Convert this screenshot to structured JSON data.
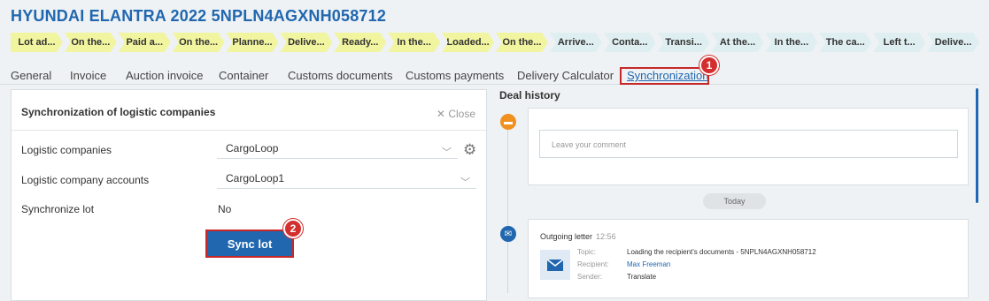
{
  "header": {
    "title": "HYUNDAI ELANTRA 2022 5NPLN4AGXNH058712"
  },
  "stages": [
    {
      "label": "Lot ad...",
      "status": "done"
    },
    {
      "label": "On the...",
      "status": "done"
    },
    {
      "label": "Paid a...",
      "status": "done"
    },
    {
      "label": "On the...",
      "status": "done"
    },
    {
      "label": "Planne...",
      "status": "done"
    },
    {
      "label": "Delive...",
      "status": "done"
    },
    {
      "label": "Ready...",
      "status": "done"
    },
    {
      "label": "In the...",
      "status": "done"
    },
    {
      "label": "Loaded...",
      "status": "done"
    },
    {
      "label": "On the...",
      "status": "done"
    },
    {
      "label": "Arrive...",
      "status": "todo"
    },
    {
      "label": "Conta...",
      "status": "todo"
    },
    {
      "label": "Transi...",
      "status": "todo"
    },
    {
      "label": "At the...",
      "status": "todo"
    },
    {
      "label": "In the...",
      "status": "todo"
    },
    {
      "label": "The ca...",
      "status": "todo"
    },
    {
      "label": "Left t...",
      "status": "todo"
    },
    {
      "label": "Delive...",
      "status": "todo"
    }
  ],
  "tabs": [
    {
      "label": "General"
    },
    {
      "label": "Invoice"
    },
    {
      "label": "Auction invoice"
    },
    {
      "label": "Container"
    },
    {
      "label": "Customs documents"
    },
    {
      "label": "Customs payments"
    },
    {
      "label": "Delivery Calculator"
    },
    {
      "label": "Synchronization",
      "active": true
    }
  ],
  "badges": {
    "first": "1",
    "second": "2"
  },
  "sync_panel": {
    "title": "Synchronization of logistic companies",
    "close_label": "Close",
    "logistic_companies_label": "Logistic companies",
    "logistic_companies_value": "CargoLoop",
    "accounts_label": "Logistic company accounts",
    "accounts_value": "CargoLoop1",
    "synchronize_lot_label": "Synchronize lot",
    "synchronize_lot_value": "No",
    "sync_button": "Sync lot"
  },
  "deal_history": {
    "title": "Deal history",
    "comment_placeholder": "Leave your comment",
    "today_label": "Today",
    "letter": {
      "title": "Outgoing letter",
      "time": "12:56",
      "topic_label": "Topic:",
      "topic_value": "Loading the recipient's documents - 5NPLN4AGXNH058712",
      "recipient_label": "Recipient:",
      "recipient_value": "Max Freeman",
      "sender_label": "Sender:",
      "sender_value": "Translate"
    }
  },
  "colors": {
    "accent": "#2067b0",
    "stage_done": "#f1f5a0",
    "stage_todo": "#dfeef0",
    "highlight": "#c62828",
    "comment_icon": "#f0901e"
  }
}
